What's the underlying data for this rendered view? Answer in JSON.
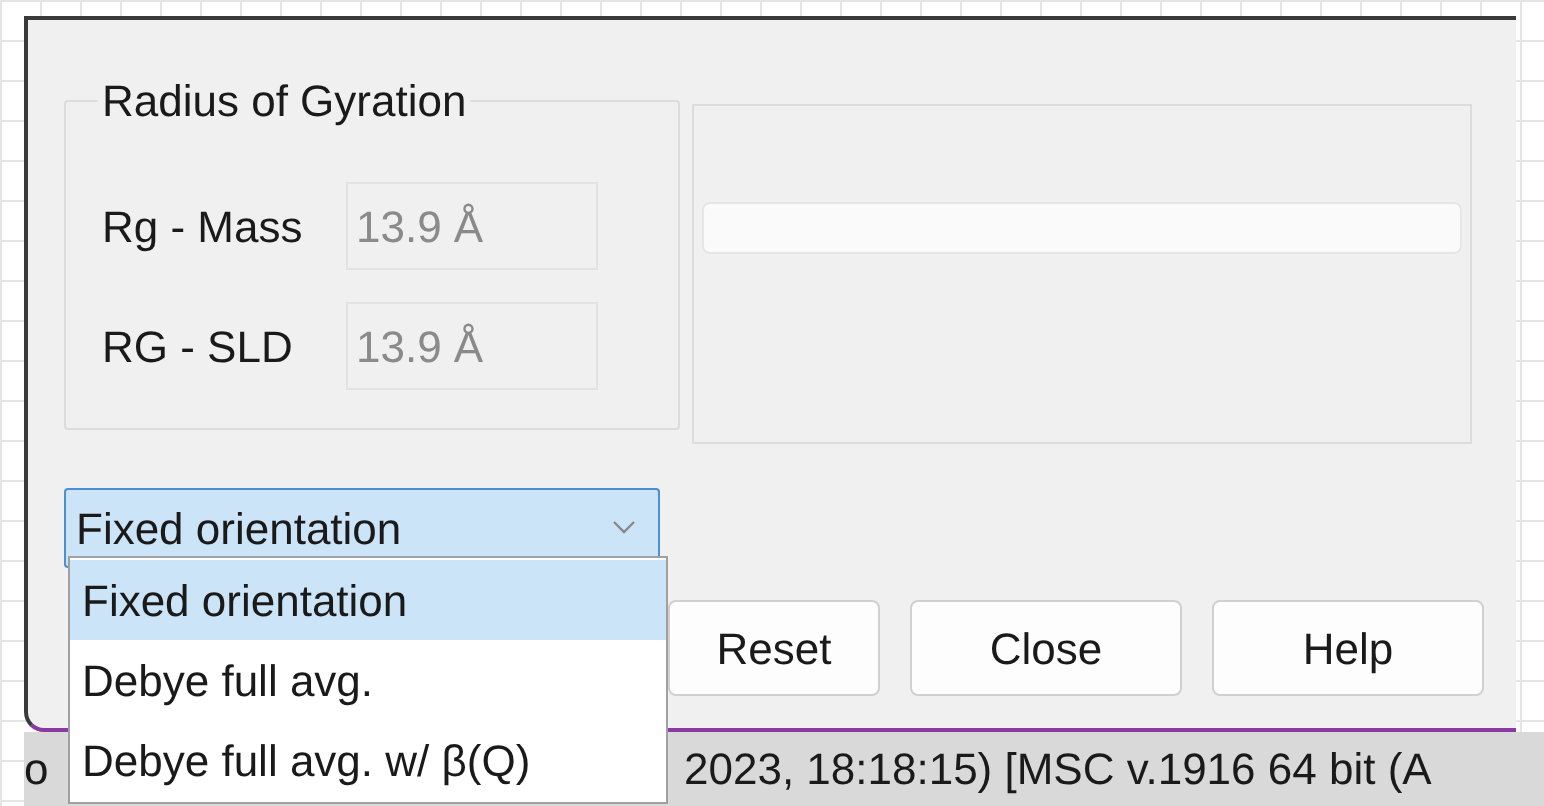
{
  "group": {
    "title": "Radius of Gyration",
    "fields": [
      {
        "label": "Rg - Mass",
        "value": "13.9 Å",
        "disabled": true
      },
      {
        "label": "RG - SLD",
        "value": "13.9 Å",
        "disabled": true
      }
    ]
  },
  "orientation_select": {
    "value": "Fixed orientation",
    "expanded": true,
    "options": [
      {
        "label": "Fixed orientation",
        "selected": true
      },
      {
        "label": "Debye full avg.",
        "selected": false
      },
      {
        "label": "Debye full avg. w/ β(Q)",
        "selected": false
      }
    ]
  },
  "buttons": [
    "Reset",
    "Close",
    "Help"
  ],
  "status_bar": {
    "left": "o",
    "right": "2023, 18:18:15) [MSC v.1916 64 bit (A"
  }
}
